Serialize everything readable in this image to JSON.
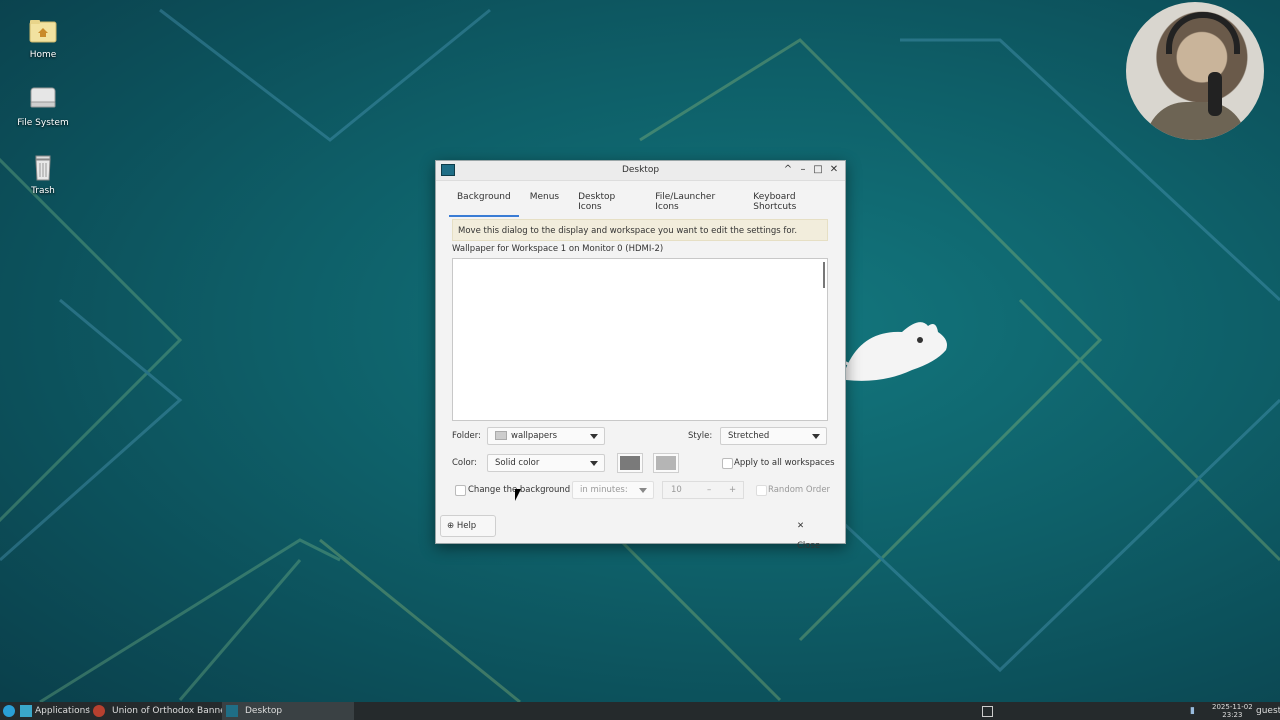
{
  "desktop": {
    "icons": [
      {
        "label": "Home",
        "icon": "home-folder-icon"
      },
      {
        "label": "File System",
        "icon": "drive-icon"
      },
      {
        "label": "Trash",
        "icon": "trash-icon"
      }
    ]
  },
  "dialog": {
    "title": "Desktop",
    "tabs": [
      "Background",
      "Menus",
      "Desktop Icons",
      "File/Launcher Icons",
      "Keyboard Shortcuts"
    ],
    "active_tab": "Background",
    "notice": "Move this dialog to the display and workspace you want to edit the settings for.",
    "wallpaper_label": "Wallpaper for Workspace 1 on Monitor 0 (HDMI-2)",
    "folder_label": "Folder:",
    "folder_value": "wallpapers",
    "style_label": "Style:",
    "style_value": "Stretched",
    "color_label": "Color:",
    "color_value": "Solid color",
    "color1": "#7a7a7a",
    "color2": "#b5b5b5",
    "apply_all_label": "Apply to all workspaces",
    "change_bg_label": "Change the background",
    "interval_value": "in minutes:",
    "interval_number": "10",
    "random_order_label": "Random Order",
    "help_label": "Help",
    "close_label": "Close"
  },
  "taskbar": {
    "applications_label": "Applications",
    "window_1": "Union of Orthodox Banner-...",
    "window_2": "Desktop",
    "date": "2025-11-02",
    "time": "23:23",
    "user": "guest"
  },
  "colors": {
    "accent": "#3a7cd4",
    "desktop_bg": "#0e5f68",
    "taskbar_bg": "#252a2c"
  }
}
